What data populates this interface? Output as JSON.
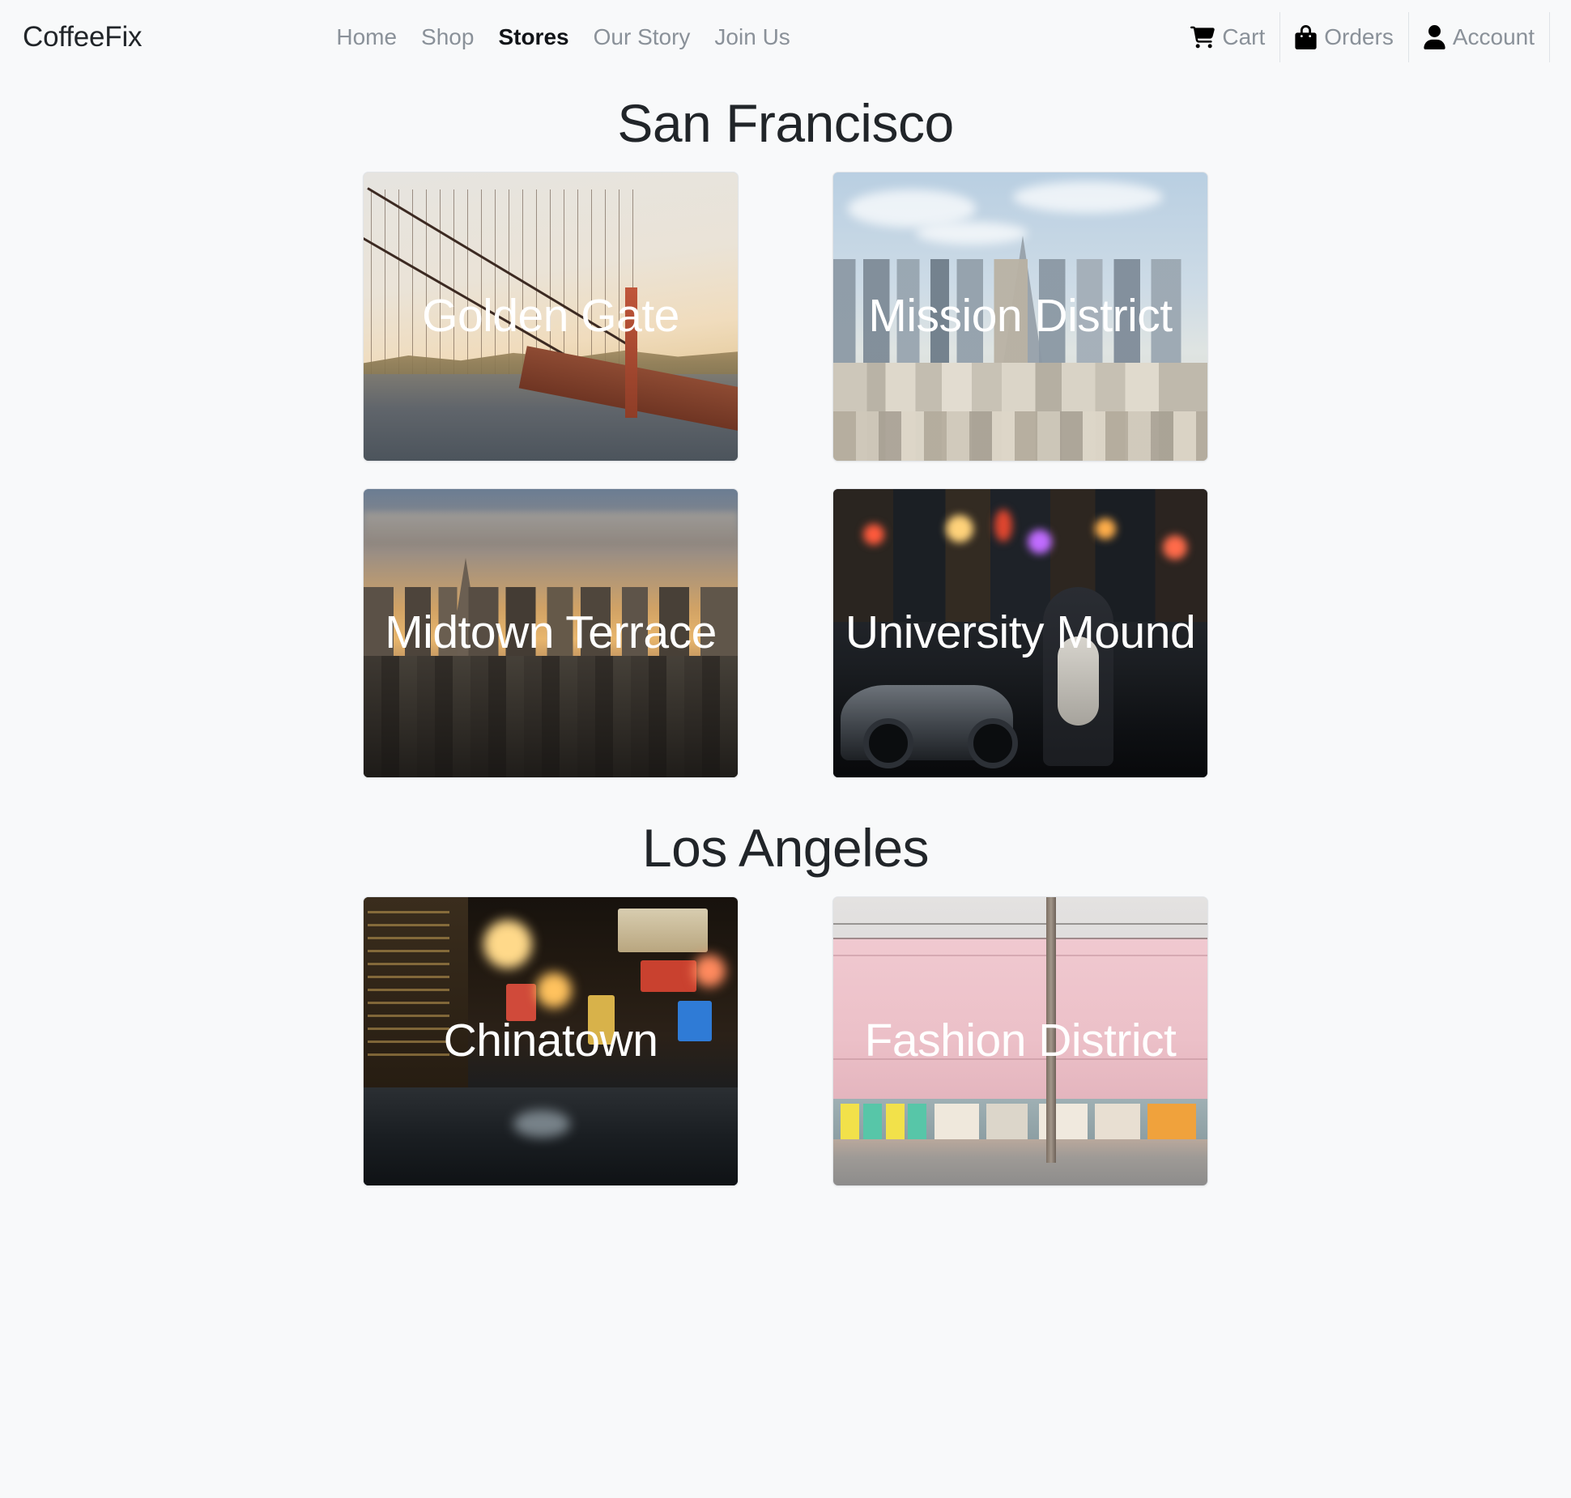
{
  "nav": {
    "brand": "CoffeeFix",
    "links": [
      {
        "label": "Home",
        "active": false
      },
      {
        "label": "Shop",
        "active": false
      },
      {
        "label": "Stores",
        "active": true
      },
      {
        "label": "Our Story",
        "active": false
      },
      {
        "label": "Join Us",
        "active": false
      }
    ],
    "utilities": [
      {
        "label": "Cart",
        "icon": "shopping-cart-icon"
      },
      {
        "label": "Orders",
        "icon": "shopping-bag-icon"
      },
      {
        "label": "Account",
        "icon": "person-icon"
      }
    ]
  },
  "sections": [
    {
      "city": "San Francisco",
      "stores": [
        {
          "name": "Golden Gate",
          "scene": "golden-gate"
        },
        {
          "name": "Mission District",
          "scene": "mission-district"
        },
        {
          "name": "Midtown Terrace",
          "scene": "midtown-terrace"
        },
        {
          "name": "University Mound",
          "scene": "university-mound"
        }
      ]
    },
    {
      "city": "Los Angeles",
      "stores": [
        {
          "name": "Chinatown",
          "scene": "chinatown"
        },
        {
          "name": "Fashion District",
          "scene": "fashion-district"
        }
      ]
    }
  ],
  "colors": {
    "page_background": "#f8f9fa",
    "heading_text": "#212529",
    "nav_link_inactive": "#8a9199",
    "nav_link_active": "#111418",
    "card_border": "#e2e5e8",
    "card_label_text": "#ffffff",
    "divider": "#dfe3e7"
  }
}
